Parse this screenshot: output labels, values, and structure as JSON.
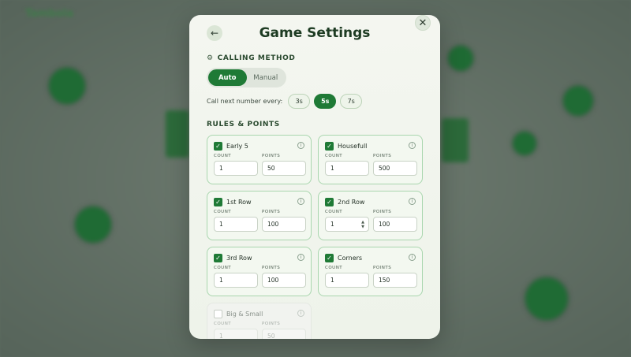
{
  "background": {
    "logo": "Tambola"
  },
  "modal": {
    "title": "Game Settings",
    "close_icon": "close-icon",
    "back_icon": "arrow-left-icon"
  },
  "calling": {
    "section_label": "CALLING METHOD",
    "modes": [
      "Auto",
      "Manual"
    ],
    "selected_mode": "Auto",
    "interval_label": "Call next number every:",
    "intervals": [
      "3s",
      "5s",
      "7s"
    ],
    "selected_interval": "5s"
  },
  "rules": {
    "section_label": "RULES & POINTS",
    "count_label": "COUNT",
    "points_label": "POINTS",
    "items": [
      {
        "name": "Early 5",
        "enabled": true,
        "count": "1",
        "points": "50"
      },
      {
        "name": "Housefull",
        "enabled": true,
        "count": "1",
        "points": "500"
      },
      {
        "name": "1st Row",
        "enabled": true,
        "count": "1",
        "points": "100"
      },
      {
        "name": "2nd Row",
        "enabled": true,
        "count": "1",
        "points": "100"
      },
      {
        "name": "3rd Row",
        "enabled": true,
        "count": "1",
        "points": "100"
      },
      {
        "name": "Corners",
        "enabled": true,
        "count": "1",
        "points": "150"
      },
      {
        "name": "Big & Small",
        "enabled": false,
        "count": "1",
        "points": "50"
      }
    ]
  },
  "colors": {
    "accent": "#1f7a36",
    "card_border": "#a9d6ae"
  }
}
